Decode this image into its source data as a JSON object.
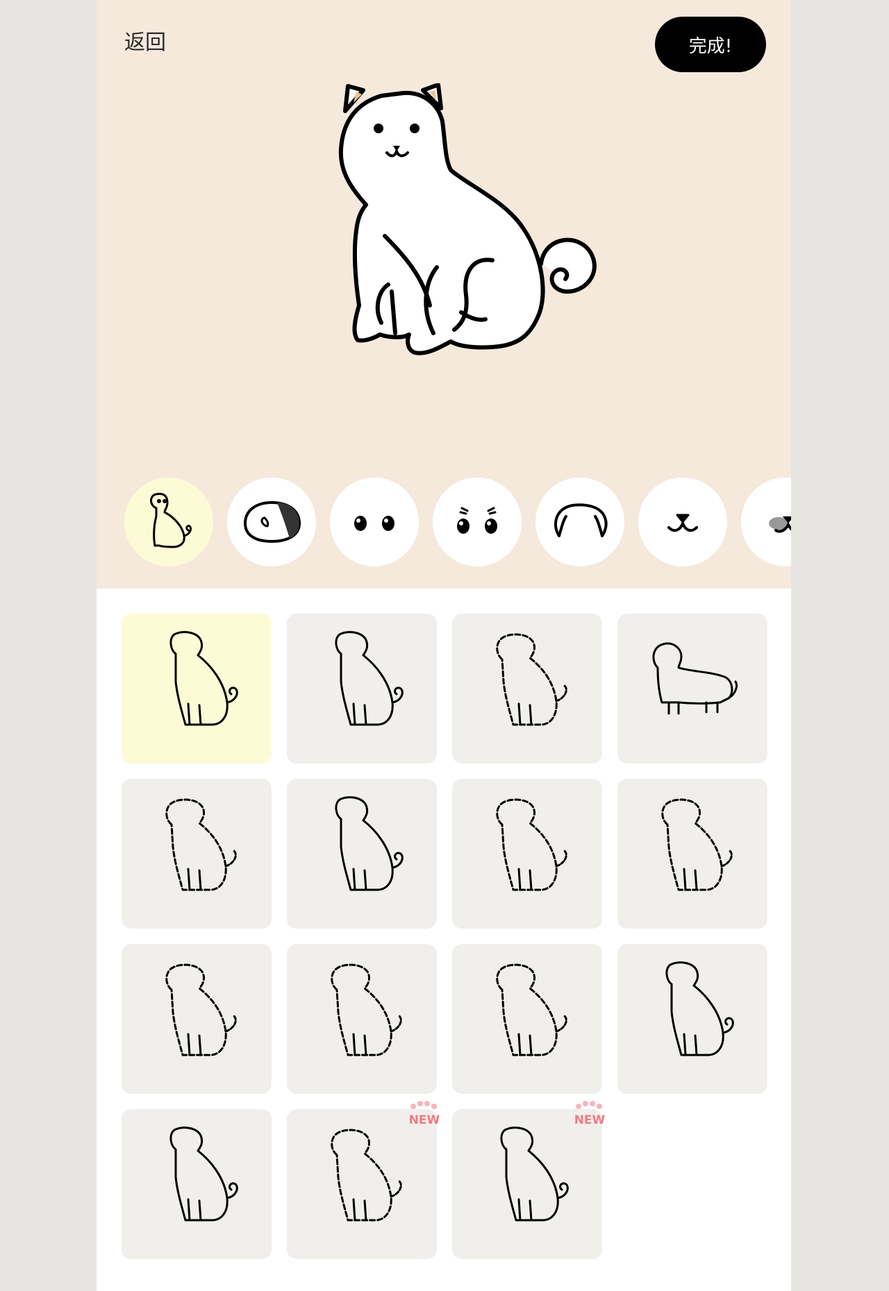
{
  "header": {
    "back_label": "返回",
    "done_label": "完成!"
  },
  "preview": {
    "selected_breed": "shiba",
    "icon": "shiba-dog-icon"
  },
  "parts_tabs": [
    {
      "id": "body",
      "icon": "dog-body-icon",
      "selected": true
    },
    {
      "id": "head-pattern",
      "icon": "head-pattern-icon",
      "selected": false
    },
    {
      "id": "eyes",
      "icon": "round-eyes-icon",
      "selected": false
    },
    {
      "id": "eyebrows",
      "icon": "eyebrow-eyes-icon",
      "selected": false
    },
    {
      "id": "ears",
      "icon": "ears-icon",
      "selected": false
    },
    {
      "id": "mouth",
      "icon": "mouth-icon",
      "selected": false
    },
    {
      "id": "nose",
      "icon": "nose-icon",
      "selected": false
    }
  ],
  "breeds": [
    {
      "id": "shiba",
      "icon": "shiba-icon",
      "selected": true,
      "is_new": false
    },
    {
      "id": "shiba-alt",
      "icon": "shiba-back-icon",
      "selected": false,
      "is_new": false
    },
    {
      "id": "poodle",
      "icon": "poodle-icon",
      "selected": false,
      "is_new": false
    },
    {
      "id": "dachshund",
      "icon": "dachshund-icon",
      "selected": false,
      "is_new": false
    },
    {
      "id": "long-hair-dachshund",
      "icon": "long-hair-dachshund-icon",
      "selected": false,
      "is_new": false
    },
    {
      "id": "chihuahua",
      "icon": "chihuahua-icon",
      "selected": false,
      "is_new": false
    },
    {
      "id": "papillon",
      "icon": "papillon-icon",
      "selected": false,
      "is_new": false
    },
    {
      "id": "schnauzer",
      "icon": "schnauzer-icon",
      "selected": false,
      "is_new": false
    },
    {
      "id": "yorkshire",
      "icon": "yorkshire-terrier-icon",
      "selected": false,
      "is_new": false
    },
    {
      "id": "shih-tzu",
      "icon": "shih-tzu-icon",
      "selected": false,
      "is_new": false
    },
    {
      "id": "pomeranian",
      "icon": "pomeranian-icon",
      "selected": false,
      "is_new": false
    },
    {
      "id": "corgi",
      "icon": "corgi-icon",
      "selected": false,
      "is_new": false
    },
    {
      "id": "french-bulldog",
      "icon": "french-bulldog-icon",
      "selected": false,
      "is_new": false
    },
    {
      "id": "golden-retriever",
      "icon": "golden-retriever-icon",
      "selected": false,
      "is_new": true
    },
    {
      "id": "jack-russell",
      "icon": "jack-russell-icon",
      "selected": false,
      "is_new": true
    }
  ],
  "new_badge_label": "NEW",
  "colors": {
    "top_background": "#f5e9dc",
    "selected_highlight": "#fdfbd6",
    "tile_background": "#f0efec",
    "done_button": "#000000",
    "new_badge": "#f07b86",
    "ear_accent": "#e9c291"
  }
}
